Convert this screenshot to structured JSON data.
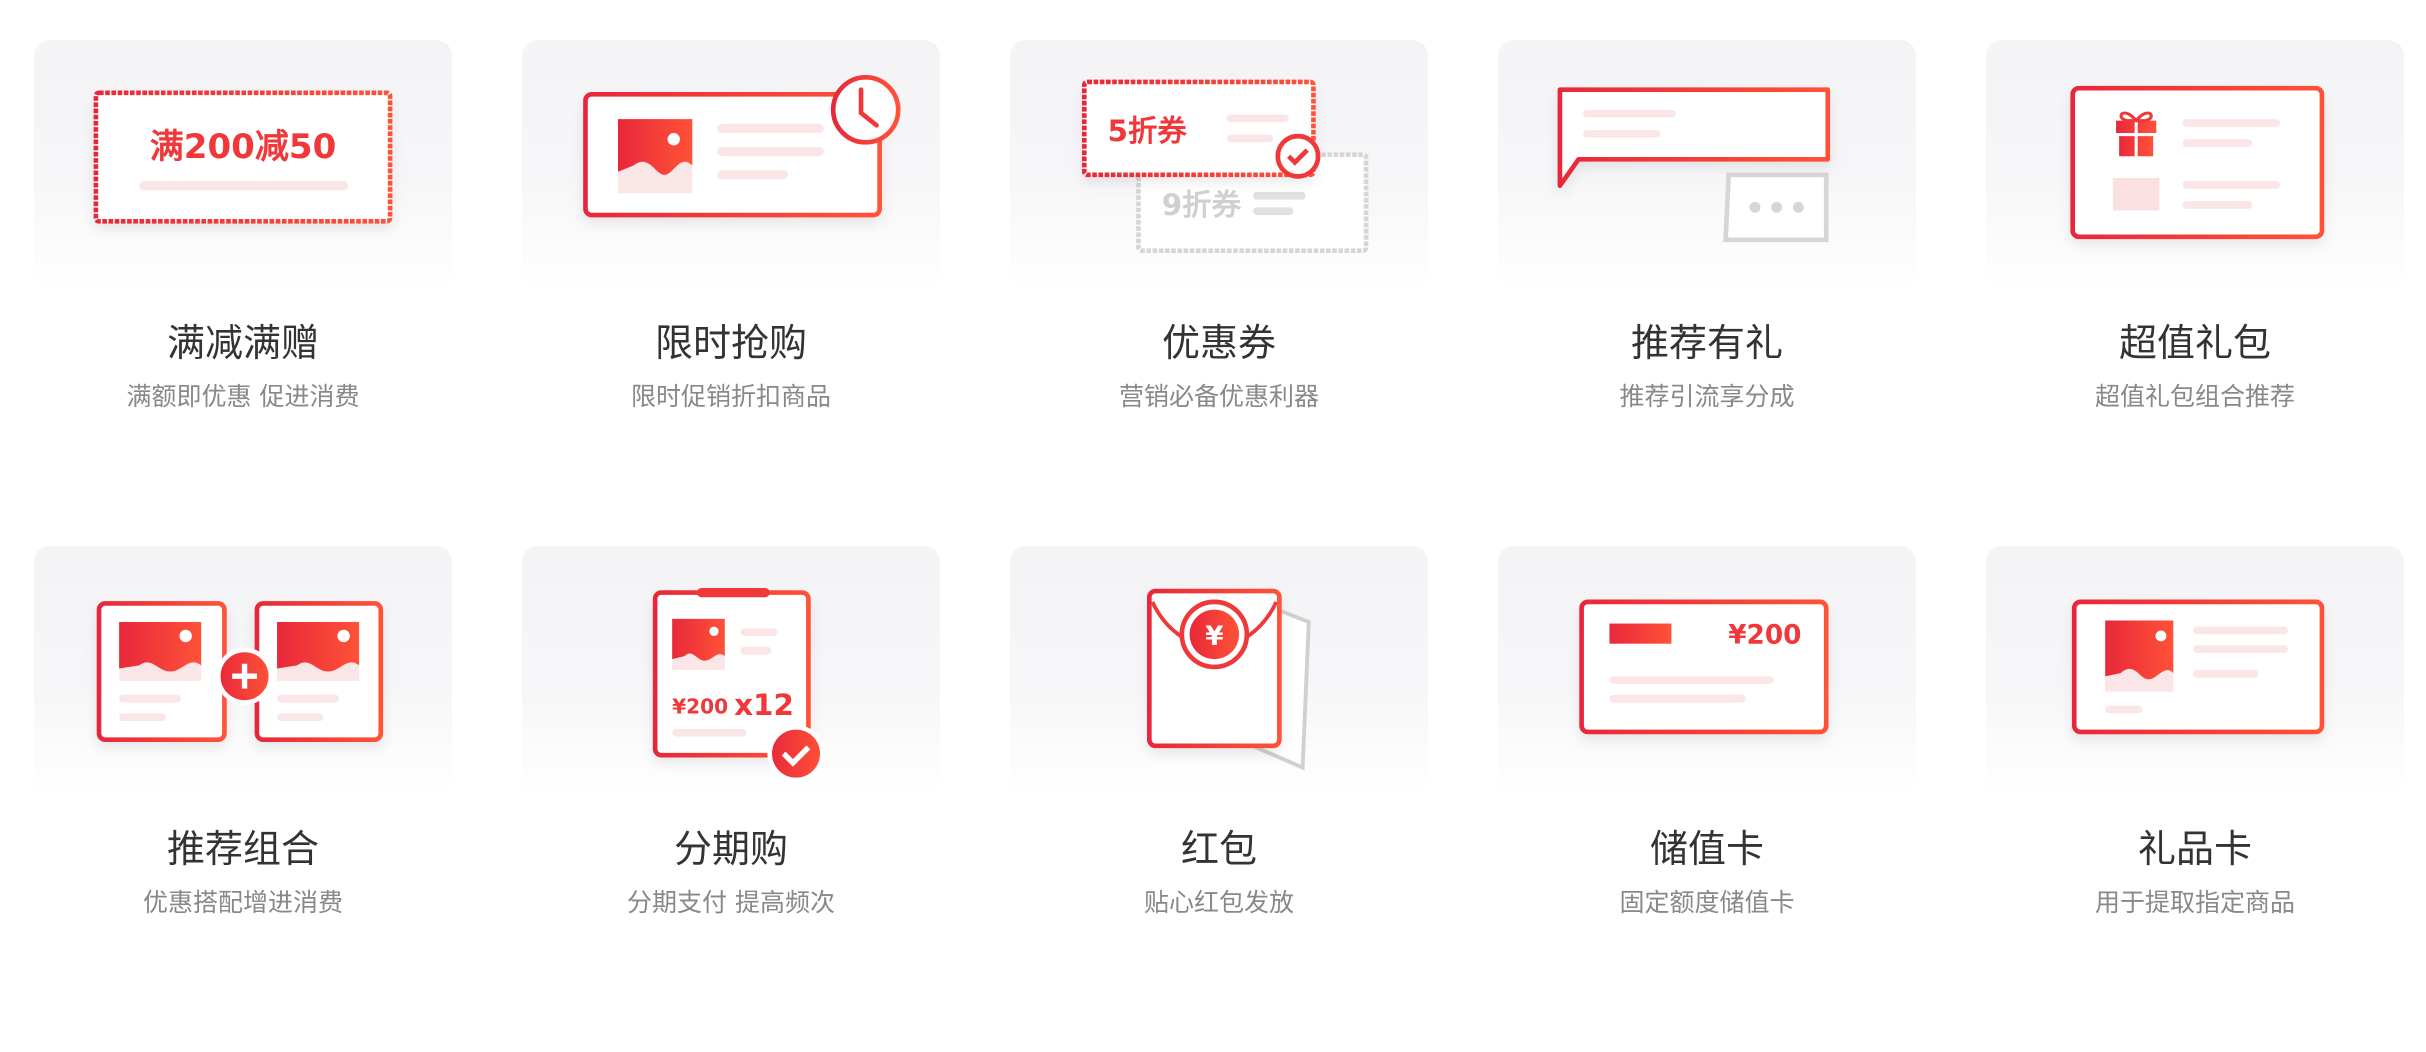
{
  "colors": {
    "accent": "#f0383a",
    "pale": "#fbe6e7",
    "gray": "#d6d6d6",
    "title": "#333333",
    "subtitle": "#888888"
  },
  "items": [
    {
      "title": "满减满赠",
      "subtitle": "满额即优惠 促进消费",
      "icon": "full-reduction-coupon-icon",
      "icon_text": "满200减50"
    },
    {
      "title": "限时抢购",
      "subtitle": "限时促销折扣商品",
      "icon": "flash-sale-clock-icon"
    },
    {
      "title": "优惠券",
      "subtitle": "营销必备优惠利器",
      "icon": "coupon-icon",
      "icon_text": "5折券",
      "icon_text2": "9折券"
    },
    {
      "title": "推荐有礼",
      "subtitle": "推荐引流享分成",
      "icon": "chat-bubble-icon"
    },
    {
      "title": "超值礼包",
      "subtitle": "超值礼包组合推荐",
      "icon": "gift-pack-icon"
    },
    {
      "title": "推荐组合",
      "subtitle": "优惠搭配增进消费",
      "icon": "bundle-plus-icon"
    },
    {
      "title": "分期购",
      "subtitle": "分期支付 提高频次",
      "icon": "installment-icon",
      "icon_text": "¥200",
      "icon_text2": "x12"
    },
    {
      "title": "红包",
      "subtitle": "贴心红包发放",
      "icon": "red-envelope-icon",
      "icon_text": "¥"
    },
    {
      "title": "储值卡",
      "subtitle": "固定额度储值卡",
      "icon": "stored-value-card-icon",
      "icon_text": "¥200"
    },
    {
      "title": "礼品卡",
      "subtitle": "用于提取指定商品",
      "icon": "gift-card-icon"
    }
  ]
}
